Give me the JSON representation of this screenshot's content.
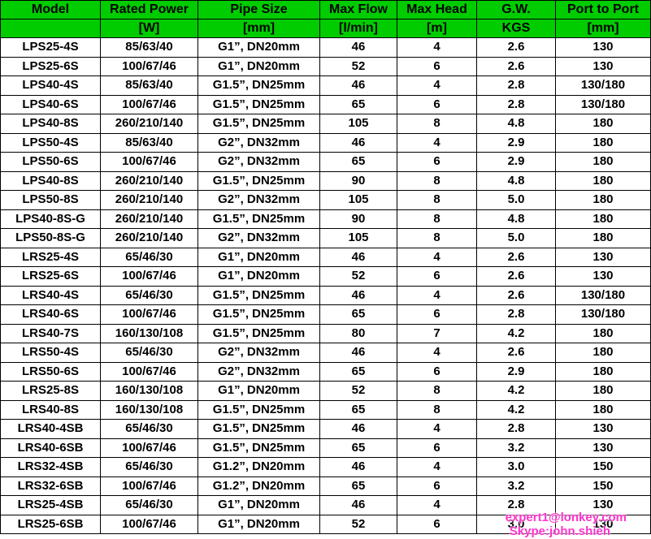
{
  "table": {
    "header_color": "#00cc00",
    "columns": [
      "Model",
      "Rated Power",
      "Pipe Size",
      "Max Flow",
      "Max Head",
      "G.W.",
      "Port to Port"
    ],
    "units": [
      "",
      "[W]",
      "[mm]",
      "[l/min]",
      "[m]",
      "KGS",
      "[mm]"
    ],
    "rows": [
      [
        "LPS25-4S",
        "85/63/40",
        "G1”, DN20mm",
        "46",
        "4",
        "2.6",
        "130"
      ],
      [
        "LPS25-6S",
        "100/67/46",
        "G1”, DN20mm",
        "52",
        "6",
        "2.6",
        "130"
      ],
      [
        "LPS40-4S",
        "85/63/40",
        "G1.5”, DN25mm",
        "46",
        "4",
        "2.8",
        "130/180"
      ],
      [
        "LPS40-6S",
        "100/67/46",
        "G1.5”, DN25mm",
        "65",
        "6",
        "2.8",
        "130/180"
      ],
      [
        "LPS40-8S",
        "260/210/140",
        "G1.5”, DN25mm",
        "105",
        "8",
        "4.8",
        "180"
      ],
      [
        "LPS50-4S",
        "85/63/40",
        "G2”, DN32mm",
        "46",
        "4",
        "2.9",
        "180"
      ],
      [
        "LPS50-6S",
        "100/67/46",
        "G2”, DN32mm",
        "65",
        "6",
        "2.9",
        "180"
      ],
      [
        "LPS40-8S",
        "260/210/140",
        "G1.5”, DN25mm",
        "90",
        "8",
        "4.8",
        "180"
      ],
      [
        "LPS50-8S",
        "260/210/140",
        "G2”, DN32mm",
        "105",
        "8",
        "5.0",
        "180"
      ],
      [
        "LPS40-8S-G",
        "260/210/140",
        "G1.5”, DN25mm",
        "90",
        "8",
        "4.8",
        "180"
      ],
      [
        "LPS50-8S-G",
        "260/210/140",
        "G2”, DN32mm",
        "105",
        "8",
        "5.0",
        "180"
      ],
      [
        "LRS25-4S",
        "65/46/30",
        "G1”, DN20mm",
        "46",
        "4",
        "2.6",
        "130"
      ],
      [
        "LRS25-6S",
        "100/67/46",
        "G1”, DN20mm",
        "52",
        "6",
        "2.6",
        "130"
      ],
      [
        "LRS40-4S",
        "65/46/30",
        "G1.5”, DN25mm",
        "46",
        "4",
        "2.6",
        "130/180"
      ],
      [
        "LRS40-6S",
        "100/67/46",
        "G1.5”, DN25mm",
        "65",
        "6",
        "2.8",
        "130/180"
      ],
      [
        "LRS40-7S",
        "160/130/108",
        "G1.5”, DN25mm",
        "80",
        "7",
        "4.2",
        "180"
      ],
      [
        "LRS50-4S",
        "65/46/30",
        "G2”, DN32mm",
        "46",
        "4",
        "2.6",
        "180"
      ],
      [
        "LRS50-6S",
        "100/67/46",
        "G2”, DN32mm",
        "65",
        "6",
        "2.9",
        "180"
      ],
      [
        "LRS25-8S",
        "160/130/108",
        "G1”, DN20mm",
        "52",
        "8",
        "4.2",
        "180"
      ],
      [
        "LRS40-8S",
        "160/130/108",
        "G1.5”, DN25mm",
        "65",
        "8",
        "4.2",
        "180"
      ],
      [
        "LRS40-4SB",
        "65/46/30",
        "G1.5”, DN25mm",
        "46",
        "4",
        "2.8",
        "130"
      ],
      [
        "LRS40-6SB",
        "100/67/46",
        "G1.5”, DN25mm",
        "65",
        "6",
        "3.2",
        "130"
      ],
      [
        "LRS32-4SB",
        "65/46/30",
        "G1.2”, DN20mm",
        "46",
        "4",
        "3.0",
        "150"
      ],
      [
        "LRS32-6SB",
        "100/67/46",
        "G1.2”, DN20mm",
        "65",
        "6",
        "3.2",
        "150"
      ],
      [
        "LRS25-4SB",
        "65/46/30",
        "G1”, DN20mm",
        "46",
        "4",
        "2.8",
        "130"
      ],
      [
        "LRS25-6SB",
        "100/67/46",
        "G1”, DN20mm",
        "52",
        "6",
        "3.0",
        "130"
      ]
    ]
  },
  "watermark": {
    "email": "expert1@lonkey.com",
    "skype": "Skype:john.shieh",
    "color": "#ff33cc"
  }
}
